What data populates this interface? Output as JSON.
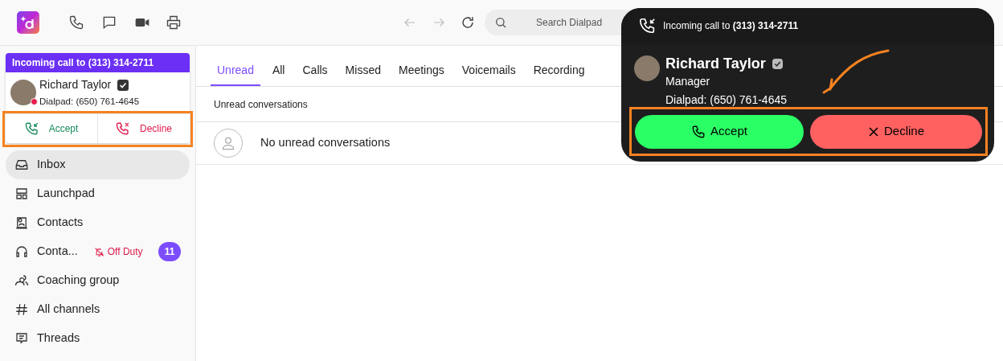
{
  "toolbar": {
    "search": {
      "placeholder": "Search Dialpad"
    }
  },
  "incoming_card": {
    "header": "Incoming call to (313) 314-2711",
    "caller_name": "Richard Taylor",
    "caller_line": "Dialpad: (650) 761-4645",
    "accept": "Accept",
    "decline": "Decline"
  },
  "sidebar": {
    "items": [
      {
        "kind": "inbox",
        "label": "Inbox",
        "selected": true
      },
      {
        "kind": "launchpad",
        "label": "Launchpad",
        "selected": false
      },
      {
        "kind": "contacts",
        "label": "Contacts",
        "selected": false
      },
      {
        "kind": "contact_center",
        "label": "Conta...",
        "selected": false,
        "status": "Off Duty",
        "badge": "11"
      },
      {
        "kind": "group",
        "label": "Coaching group",
        "selected": false
      },
      {
        "kind": "channels",
        "label": "All channels",
        "selected": false
      },
      {
        "kind": "threads",
        "label": "Threads",
        "selected": false
      }
    ]
  },
  "tabs": [
    {
      "label": "Unread",
      "selected": true
    },
    {
      "label": "All",
      "selected": false
    },
    {
      "label": "Calls",
      "selected": false
    },
    {
      "label": "Missed",
      "selected": false
    },
    {
      "label": "Meetings",
      "selected": false
    },
    {
      "label": "Voicemails",
      "selected": false
    },
    {
      "label": "Recording",
      "selected": false
    }
  ],
  "section_title": "Unread conversations",
  "empty_message": "No unread conversations",
  "popup": {
    "header": "Incoming call to **(313) 314-2711**",
    "caller_name": "Richard Taylor",
    "caller_role": "Manager",
    "caller_line": "Dialpad: (650) 761-4645",
    "accept": "Accept",
    "decline": "Decline"
  }
}
